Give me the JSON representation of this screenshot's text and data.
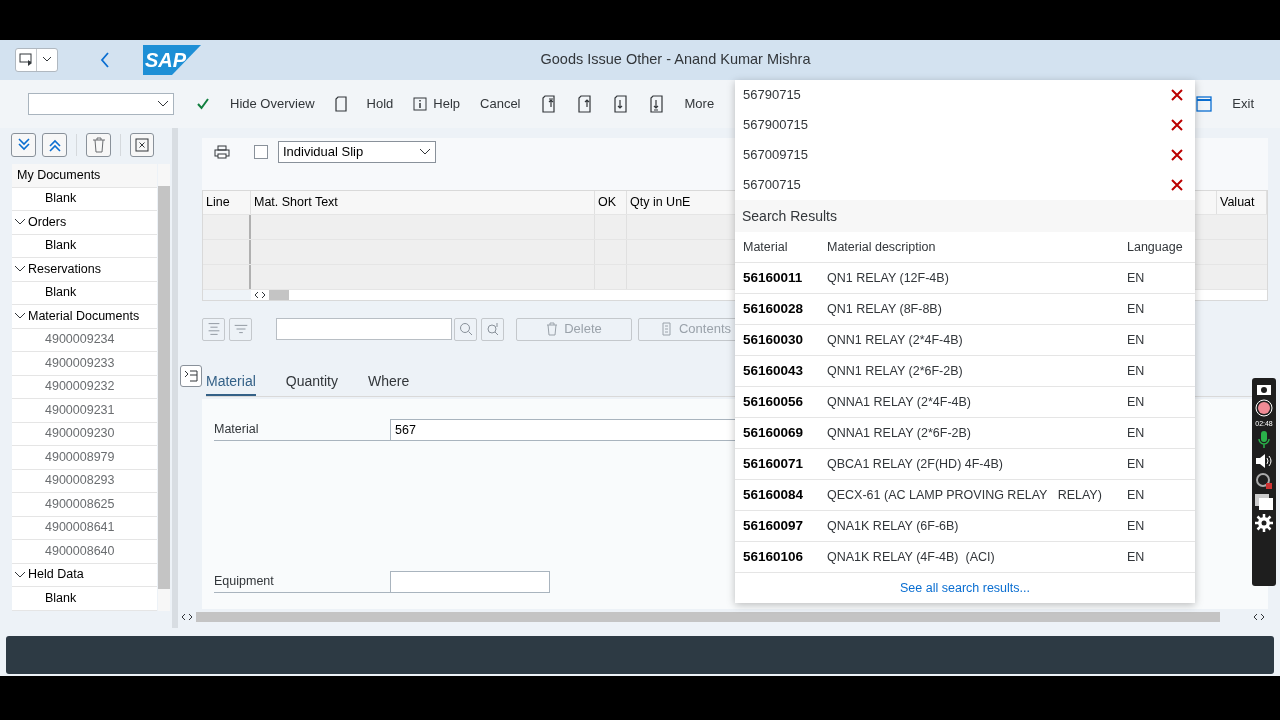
{
  "header": {
    "logo": "SAP",
    "title": "Goods Issue Other - Anand Kumar Mishra"
  },
  "toolbar": {
    "items": [
      {
        "kind": "tick"
      },
      {
        "kind": "text",
        "label": "Hide Overview"
      },
      {
        "kind": "page"
      },
      {
        "kind": "text",
        "label": "Hold"
      },
      {
        "kind": "info",
        "label": "Help"
      },
      {
        "kind": "text",
        "label": "Cancel"
      },
      {
        "kind": "first"
      },
      {
        "kind": "previous"
      },
      {
        "kind": "next"
      },
      {
        "kind": "last"
      },
      {
        "kind": "menu",
        "label": "More"
      }
    ],
    "exit": "Exit"
  },
  "sidebar": {
    "items": [
      {
        "label": "My Documents",
        "kind": "section",
        "children": [
          {
            "label": "Blank",
            "kind": "placeholder"
          }
        ]
      },
      {
        "label": "Orders",
        "kind": "folder",
        "expanded": true,
        "children": [
          {
            "label": "Blank",
            "kind": "placeholder"
          }
        ]
      },
      {
        "label": "Reservations",
        "kind": "folder",
        "expanded": true,
        "children": [
          {
            "label": "Blank",
            "kind": "placeholder"
          }
        ]
      },
      {
        "label": "Material Documents",
        "kind": "folder",
        "expanded": true,
        "children": [
          {
            "label": "4900009234",
            "kind": "document"
          },
          {
            "label": "4900009233",
            "kind": "document"
          },
          {
            "label": "4900009232",
            "kind": "document"
          },
          {
            "label": "4900009231",
            "kind": "document"
          },
          {
            "label": "4900009230",
            "kind": "document"
          },
          {
            "label": "4900008979",
            "kind": "document"
          },
          {
            "label": "4900008293",
            "kind": "document"
          },
          {
            "label": "4900008625",
            "kind": "document"
          },
          {
            "label": "4900008641",
            "kind": "document"
          },
          {
            "label": "4900008640",
            "kind": "document"
          }
        ]
      },
      {
        "label": "Held Data",
        "kind": "folder",
        "expanded": true,
        "children": [
          {
            "label": "Blank",
            "kind": "placeholder"
          }
        ]
      }
    ]
  },
  "print": {
    "checked": false,
    "slip": "Individual Slip"
  },
  "table": {
    "columns": [
      "Line",
      "Mat. Short Text",
      "OK",
      "Qty in UnE",
      "Valuat"
    ]
  },
  "table_toolbar": {
    "buttons": [
      {
        "label": "Delete",
        "disabled": true
      },
      {
        "label": "Contents",
        "disabled": true
      }
    ]
  },
  "tabs": [
    {
      "label": "Material",
      "selected": true
    },
    {
      "label": "Quantity",
      "selected": false
    },
    {
      "label": "Where",
      "selected": false
    }
  ],
  "fields": [
    {
      "label": "Material",
      "value": "567"
    },
    {
      "label": "Equipment"
    }
  ],
  "suggestions": {
    "history": [
      "56790715",
      "567900715",
      "567009715",
      "56700715"
    ],
    "heading": "Search Results",
    "columns": [
      "Material",
      "Material description",
      "Language"
    ],
    "rows": [
      [
        "56160011",
        "QN1 RELAY (12F-4B)",
        "EN"
      ],
      [
        "56160028",
        "QN1 RELAY (8F-8B)",
        "EN"
      ],
      [
        "56160030",
        "QNN1 RELAY (2*4F-4B)",
        "EN"
      ],
      [
        "56160043",
        "QNN1 RELAY (2*6F-2B)",
        "EN"
      ],
      [
        "56160056",
        "QNNA1 RELAY (2*4F-4B)",
        "EN"
      ],
      [
        "56160069",
        "QNNA1 RELAY (2*6F-2B)",
        "EN"
      ],
      [
        "56160071",
        "QBCA1 RELAY (2F(HD) 4F-4B)",
        "EN"
      ],
      [
        "56160084",
        "QECX-61 (AC LAMP PROVING RELAY   RELAY)",
        "EN"
      ],
      [
        "56160097",
        "QNA1K RELAY (6F-6B)",
        "EN"
      ],
      [
        "56160106",
        "QNA1K RELAY (4F-4B)  (ACI)",
        "EN"
      ]
    ],
    "link": "See all search results..."
  },
  "recorder": {
    "time": "02:48"
  }
}
